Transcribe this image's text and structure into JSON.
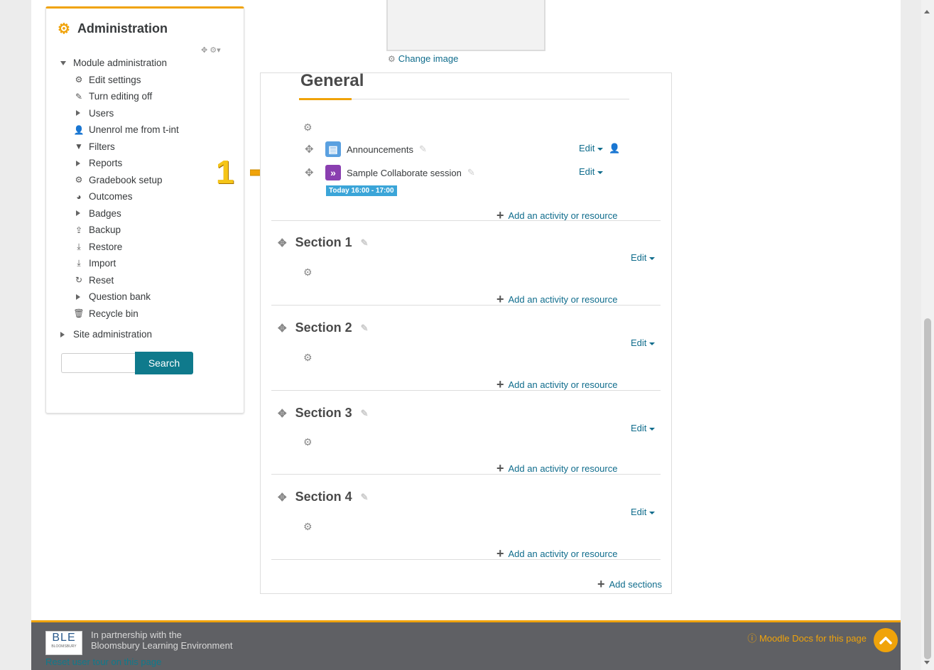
{
  "admin": {
    "title": "Administration",
    "controls": "✥ ⚙▾",
    "module_admin": "Module administration",
    "items": [
      {
        "label": "Edit settings",
        "icon": "gear-icon",
        "glyph": "⚙"
      },
      {
        "label": "Turn editing off",
        "icon": "pencil-icon",
        "glyph": "✎"
      },
      {
        "label": "Users",
        "icon": "expand-icon",
        "glyph": ""
      },
      {
        "label": "Unenrol me from t-int",
        "icon": "user-icon",
        "glyph": "👤"
      },
      {
        "label": "Filters",
        "icon": "filter-icon",
        "glyph": "▼"
      },
      {
        "label": "Reports",
        "icon": "expand-icon",
        "glyph": ""
      },
      {
        "label": "Gradebook setup",
        "icon": "gear-icon",
        "glyph": "⚙"
      },
      {
        "label": "Outcomes",
        "icon": "outcomes-icon",
        "glyph": "◕"
      },
      {
        "label": "Badges",
        "icon": "expand-icon",
        "glyph": ""
      },
      {
        "label": "Backup",
        "icon": "upload-icon",
        "glyph": "⇪"
      },
      {
        "label": "Restore",
        "icon": "download-icon",
        "glyph": "⤓"
      },
      {
        "label": "Import",
        "icon": "download-icon",
        "glyph": "⤓"
      },
      {
        "label": "Reset",
        "icon": "reset-icon",
        "glyph": "↻"
      },
      {
        "label": "Question bank",
        "icon": "expand-icon",
        "glyph": ""
      },
      {
        "label": "Recycle bin",
        "icon": "trash-icon",
        "glyph": "🗑"
      }
    ],
    "site_admin": "Site administration",
    "search_button": "Search",
    "search_value": ""
  },
  "change_image": "Change image",
  "general": {
    "title": "General",
    "activities": [
      {
        "label": "Announcements",
        "edit": "Edit"
      },
      {
        "label": "Sample Collaborate session",
        "edit": "Edit",
        "badge": "Today 16:00 - 17:00"
      }
    ],
    "add_activity": "Add an activity or resource"
  },
  "sections": [
    {
      "title": "Section 1",
      "edit": "Edit",
      "add_activity": "Add an activity or resource"
    },
    {
      "title": "Section 2",
      "edit": "Edit",
      "add_activity": "Add an activity or resource"
    },
    {
      "title": "Section 3",
      "edit": "Edit",
      "add_activity": "Add an activity or resource"
    },
    {
      "title": "Section 4",
      "edit": "Edit",
      "add_activity": "Add an activity or resource"
    }
  ],
  "add_sections": "Add sections",
  "annotation_number": "1",
  "footer": {
    "logo_big": "BLE",
    "logo_small": "BLOOMSBURY",
    "line1": "In partnership with the",
    "line2": "Bloomsbury Learning Environment",
    "reset_tour": "Reset user tour on this page",
    "docs": "Moodle Docs for this page"
  },
  "colors": {
    "accent": "#f0a30a",
    "link": "#0f6c8c",
    "button": "#0f7a8c",
    "footer": "#5f6064"
  }
}
